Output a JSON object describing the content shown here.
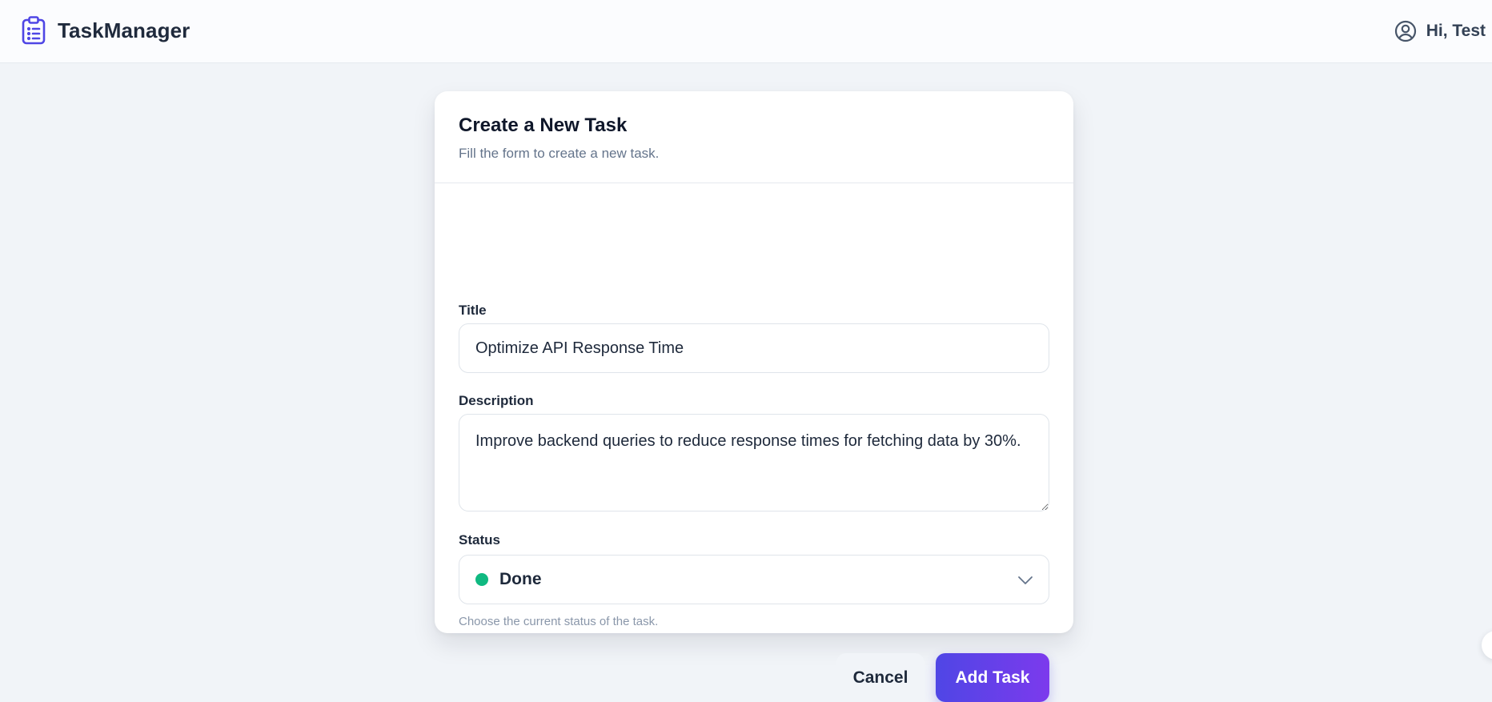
{
  "app": {
    "name": "TaskManager",
    "brand_color": "#4f46e5",
    "icon": "clipboard-list-icon"
  },
  "user": {
    "greeting": "Hi, Test",
    "icon": "user-circle-icon"
  },
  "form": {
    "title": "Create a New Task",
    "subtitle": "Fill the form to create a new task.",
    "title_field": {
      "label": "Title",
      "value": "Optimize API Response Time"
    },
    "description_field": {
      "label": "Description",
      "value": "Improve backend queries to reduce response times for fetching data by 30%."
    },
    "status_field": {
      "label": "Status",
      "value": "Done",
      "status_color": "#10b981",
      "help": "Choose the current status of the task."
    },
    "cancel_label": "Cancel",
    "submit_label": "Add Task",
    "submit_gradient": [
      "#4f46e5",
      "#7c3aed"
    ]
  }
}
